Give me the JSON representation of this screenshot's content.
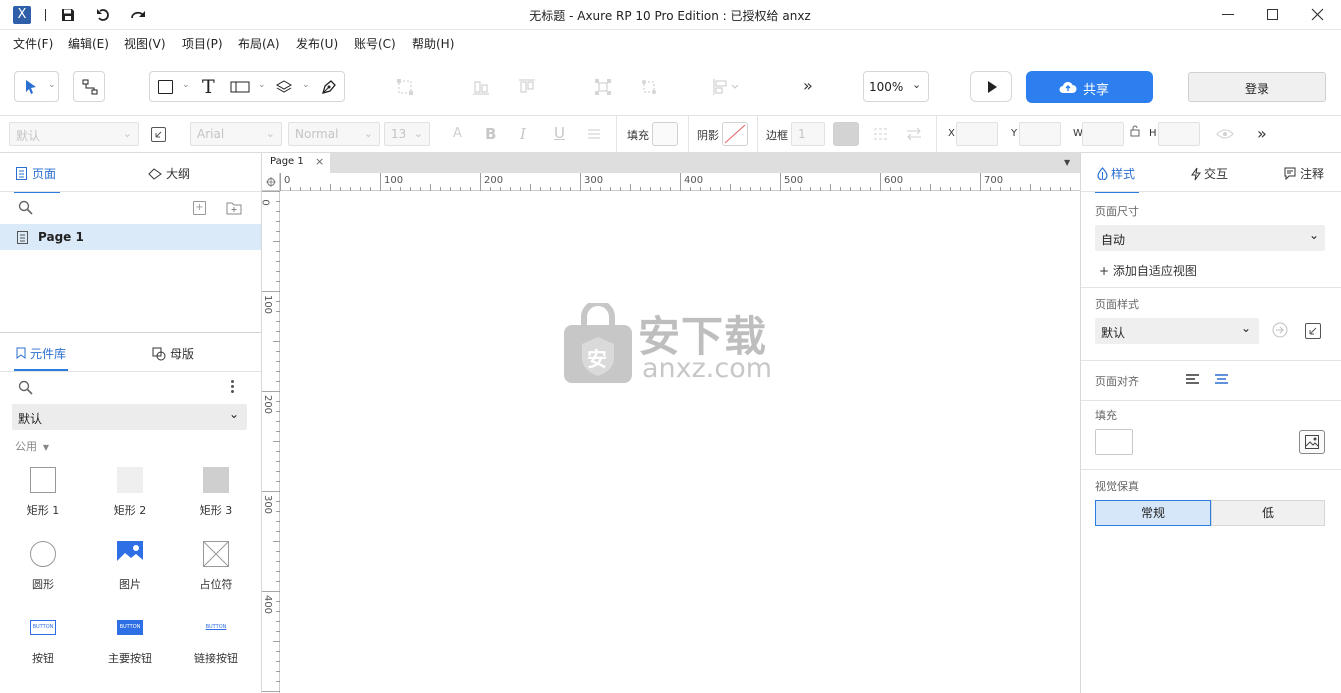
{
  "window": {
    "title": "无标题 - Axure RP 10 Pro Edition : 已授权给 anxz"
  },
  "menu": [
    "文件(F)",
    "编辑(E)",
    "视图(V)",
    "项目(P)",
    "布局(A)",
    "发布(U)",
    "账号(C)",
    "帮助(H)"
  ],
  "toolbar": {
    "zoom": "100%",
    "share_label": "共享",
    "login_label": "登录",
    "more": "»"
  },
  "stylebar": {
    "style_select": "默认",
    "font_select": "Arial",
    "weight_select": "Normal",
    "size_select": "13",
    "fill_label": "填充",
    "shadow_label": "阴影",
    "border_label": "边框",
    "border_value": "1",
    "x_label": "X",
    "y_label": "Y",
    "w_label": "W",
    "h_label": "H",
    "more": "»"
  },
  "left": {
    "pages_tab": "页面",
    "outline_tab": "大纲",
    "page_item": "Page 1",
    "library_tab": "元件库",
    "masters_tab": "母版",
    "library_select": "默认",
    "group_label": "公用",
    "widgets": [
      {
        "label": "矩形 1"
      },
      {
        "label": "矩形 2"
      },
      {
        "label": "矩形 3"
      },
      {
        "label": "圆形"
      },
      {
        "label": "图片"
      },
      {
        "label": "占位符"
      },
      {
        "label": "按钮"
      },
      {
        "label": "主要按钮"
      },
      {
        "label": "链接按钮"
      }
    ],
    "button_text": "BUTTON"
  },
  "canvas": {
    "tab_label": "Page 1",
    "ruler_h": [
      "0",
      "100",
      "200",
      "300",
      "400",
      "500",
      "600",
      "700"
    ],
    "ruler_v": [
      "0",
      "100",
      "200",
      "300",
      "400"
    ],
    "watermark_cn": "安下载",
    "watermark_en": "anxz.com",
    "watermark_badge": "安"
  },
  "right": {
    "style_tab": "样式",
    "interact_tab": "交互",
    "notes_tab": "注释",
    "page_size_label": "页面尺寸",
    "page_size_value": "自动",
    "add_adaptive": "+ 添加自适应视图",
    "page_style_label": "页面样式",
    "page_style_value": "默认",
    "page_align_label": "页面对齐",
    "fill_label": "填充",
    "fidelity_label": "视觉保真",
    "fidelity_normal": "常规",
    "fidelity_low": "低"
  },
  "colors": {
    "accent": "#2b7de0",
    "share_button": "#2d7ff0"
  }
}
